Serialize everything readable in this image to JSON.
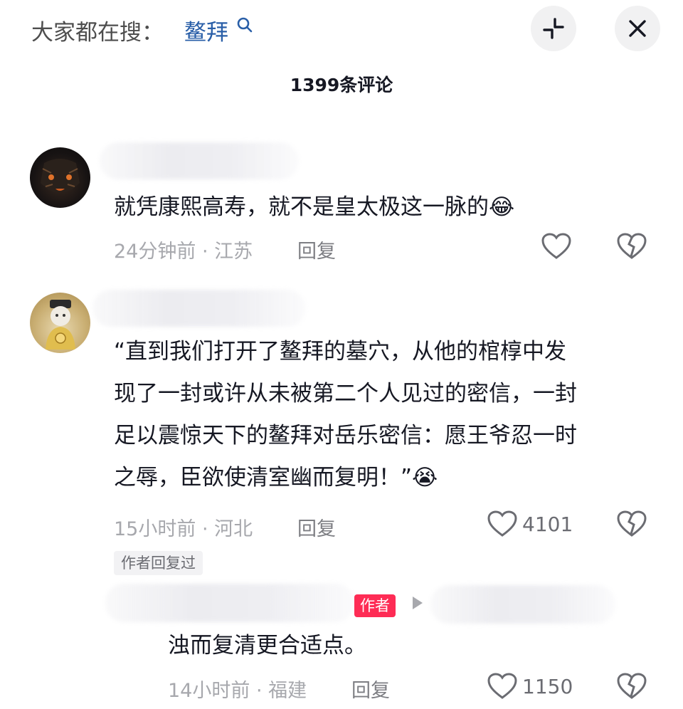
{
  "search": {
    "prefix": "大家都在搜：",
    "term": "鳌拜"
  },
  "comments_title": "1399条评论",
  "comments": [
    {
      "text": "就凭康熙高寿，就不是皇太极这一脉的😂",
      "meta": "24分钟前 · 江苏",
      "reply_label": "回复",
      "likes": ""
    },
    {
      "text_lines": [
        "“直到我们打开了鳌拜的墓穴，从他的棺椁中发",
        "现了一封或许从未被第二个人见过的密信，一封",
        "足以震惊天下的鳌拜对岳乐密信：愿王爷忍一时",
        "之辱，臣欲使清室幽而复明！”😭"
      ],
      "meta": "15小时前 · 河北",
      "reply_label": "回复",
      "likes": "4101",
      "author_replied_tag": "作者回复过"
    }
  ],
  "reply": {
    "author_badge": "作者",
    "text": "浊而复清更合适点。",
    "meta": "14小时前 · 福建",
    "reply_label": "回复",
    "likes": "1150"
  },
  "colors": {
    "accent": "#fe2c55",
    "search_term": "#2a5fa8",
    "meta": "#a7a8ad"
  },
  "icons": [
    "search-icon",
    "collapse-icon",
    "close-icon",
    "heart-icon",
    "broken-heart-icon"
  ]
}
